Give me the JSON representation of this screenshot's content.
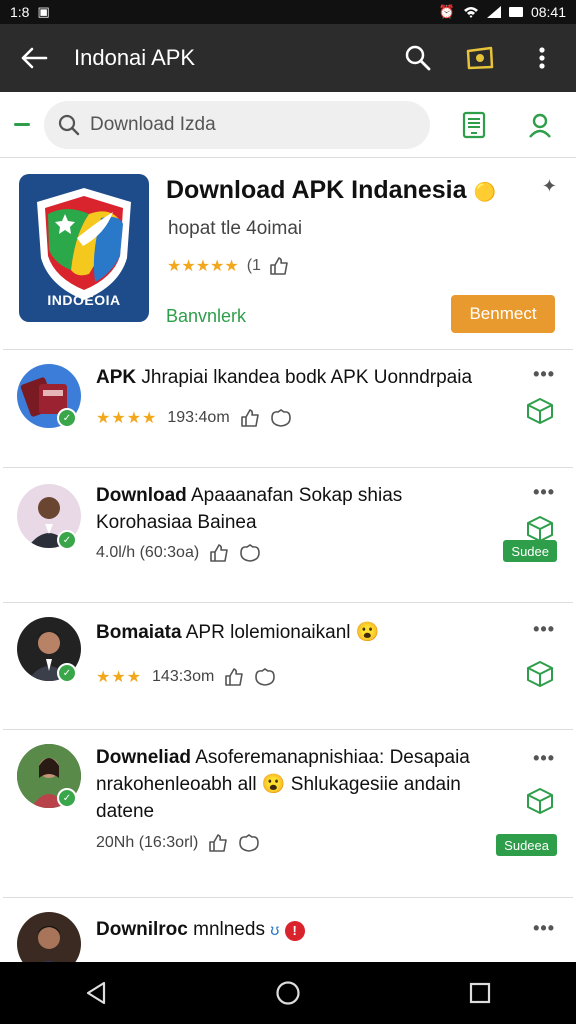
{
  "status": {
    "time": "1:8",
    "clock": "08:41"
  },
  "appbar": {
    "title": "Indonai APK"
  },
  "search": {
    "placeholder": "Download Izda"
  },
  "featured": {
    "title": "Download APK Indanesia",
    "subtitle": "hopat tle 4oimai",
    "rating_stars": "★★★★★",
    "rating_count": "(1",
    "logo_text": "INDOEOIA",
    "developer": "Banvnlerk",
    "button": "Benmect"
  },
  "items": [
    {
      "title_bold": "APK",
      "title_rest": " Jhrapiai lkandea bodk APK Uonndrpaia",
      "stars": "★★★★",
      "meta": "193:4om",
      "badge": ""
    },
    {
      "title_bold": "Download",
      "title_rest": " Apaaanafan Sokap shias Korohasiaa Bainea",
      "stars": "",
      "meta": "4.0l/h   (60:3oa)",
      "badge": "Sudee"
    },
    {
      "title_bold": "Bomaiata",
      "title_rest": " APR lolemionaikanl 😮",
      "stars": "★★★",
      "meta": "143:3om",
      "badge": ""
    },
    {
      "title_bold": "Downeliad",
      "title_rest": " Asoferemanapnishiaa: Desapaia nrakohenleoabh all 😮 Shlukagesiie andain datene",
      "stars": "",
      "meta": "20Nh   (16:3orl)",
      "badge": "Sudeea"
    },
    {
      "title_bold": "Downilroc",
      "title_rest": " mnlneds",
      "stars": "",
      "meta": "",
      "badge": ""
    }
  ],
  "colors": {
    "accent": "#2e9e4a",
    "install": "#e89a2e",
    "appbar": "#2c2c2c",
    "star": "#f2a81d"
  }
}
